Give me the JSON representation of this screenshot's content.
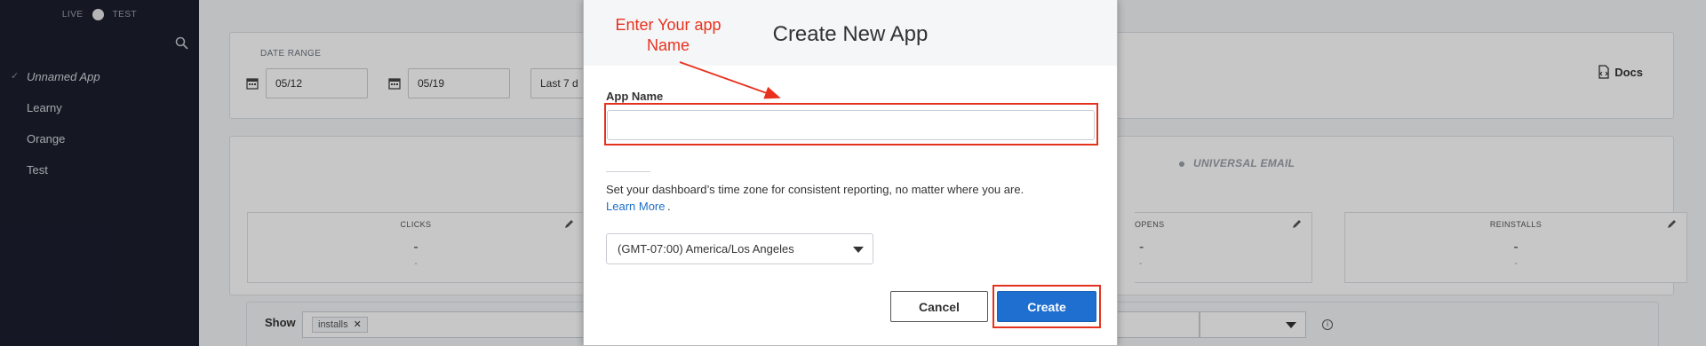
{
  "sidebar": {
    "env_live": "LIVE",
    "env_test": "TEST",
    "apps": [
      {
        "label": "Unnamed App",
        "current": true
      },
      {
        "label": "Learny"
      },
      {
        "label": "Orange"
      },
      {
        "label": "Test"
      }
    ]
  },
  "main": {
    "date_range_label": "DATE RANGE",
    "start_date": "05/12",
    "end_date": "05/19",
    "range_preset": "Last 7 d",
    "docs_label": "Docs",
    "universal_email": "UNIVERSAL EMAIL",
    "metrics": [
      {
        "label": "CLICKS",
        "value": "-",
        "sub": "-"
      },
      {
        "label": "OPENS",
        "value": "-",
        "sub": "-"
      },
      {
        "label": "REINSTALLS",
        "value": "-",
        "sub": "-"
      }
    ],
    "show_label": "Show",
    "show_chip": "installs"
  },
  "modal": {
    "title": "Create New App",
    "annotation": "Enter Your app Name",
    "annotation_color": "#e8321f",
    "app_name_label": "App Name",
    "app_name_value": "",
    "timezone_help": "Set your dashboard’s time zone for consistent reporting, no matter where you are.",
    "learn_more": "Learn More",
    "learn_more_suffix": ".",
    "timezone_value": "(GMT-07:00) America/Los Angeles",
    "cancel_label": "Cancel",
    "create_label": "Create",
    "primary_color": "#1f6fd0"
  }
}
